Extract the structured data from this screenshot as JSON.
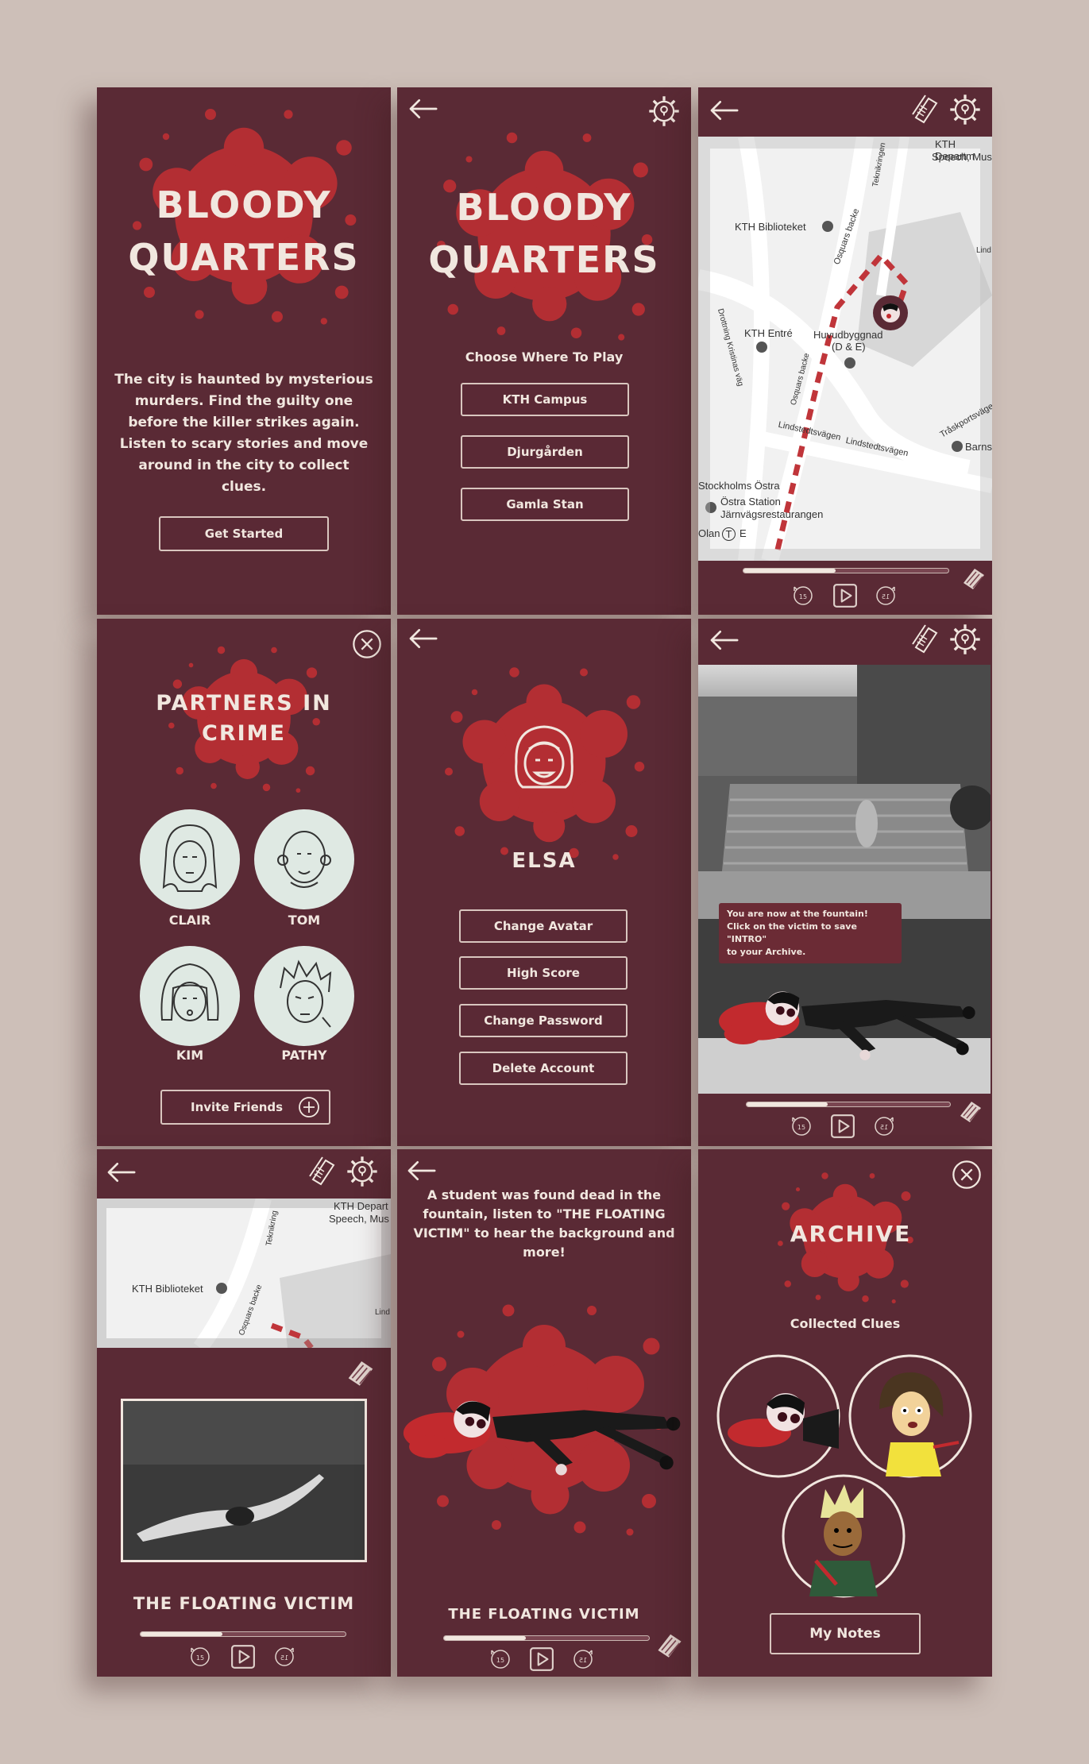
{
  "app": {
    "title_line1": "BLOODY",
    "title_line2": "QUARTERS"
  },
  "colors": {
    "bg": "#cdbfb8",
    "screen": "#5a2a35",
    "blood": "#b32e33",
    "text": "#f1e7df",
    "avatar_bg": "#dfe9e3"
  },
  "screen1": {
    "intro": [
      "The city is haunted by mysterious",
      "murders. Find the guilty one",
      "before the killer strikes again.",
      "Listen to scary stories and move",
      "around in the city to collect",
      "clues."
    ],
    "get_started": "Get Started"
  },
  "screen2": {
    "choose": "Choose Where To Play",
    "options": [
      "KTH Campus",
      "Djurgården",
      "Gamla Stan"
    ]
  },
  "screen3": {
    "map_labels": [
      "KTH Departm",
      "Speech, Mus",
      "KTH Biblioteket",
      "KTH Entré",
      "Huvudbyggnad",
      "(D & E)",
      "Teknikringen",
      "Osquars backe",
      "Lindstedtsvägen",
      "Lindstedtsvägen",
      "Tråskportsvägen",
      "Barns",
      "Stockholms Östra",
      "Östra Station",
      "Järnvägsrestaurangen",
      "Olan",
      "T",
      "E",
      "Drottning Kristinas väg",
      "Osquars backe",
      "Lind"
    ],
    "skip_back": "15",
    "skip_fwd": "15",
    "progress": 0.45
  },
  "screen4": {
    "title_line1": "PARTNERS IN",
    "title_line2": "CRIME",
    "partners": [
      "CLAIR",
      "TOM",
      "KIM",
      "PATHY"
    ],
    "invite": "Invite Friends"
  },
  "screen5": {
    "name": "ELSA",
    "options": [
      "Change Avatar",
      "High Score",
      "Change Password",
      "Delete Account"
    ]
  },
  "screen6": {
    "tooltip": [
      "You are now at the fountain!",
      "Click on the victim to save \"INTRO\"",
      "to your Archive."
    ],
    "skip_back": "15",
    "skip_fwd": "15",
    "progress": 0.4
  },
  "screen7": {
    "map_labels": [
      "KTH Depart",
      "Speech, Mus",
      "KTH Biblioteket",
      "Teknikring",
      "Osquars backe",
      "Lind"
    ],
    "track_title": "THE FLOATING VICTIM",
    "skip_back": "15",
    "skip_fwd": "15",
    "progress": 0.4
  },
  "screen8": {
    "message": [
      "A student was found dead in the",
      "fountain, listen to \"THE FLOATING",
      "VICTIM\" to hear the background and",
      "more!"
    ],
    "track_title": "THE FLOATING VICTIM",
    "skip_back": "15",
    "skip_fwd": "15",
    "progress": 0.4
  },
  "screen9": {
    "title": "ARCHIVE",
    "subtitle": "Collected Clues",
    "notes": "My Notes"
  }
}
